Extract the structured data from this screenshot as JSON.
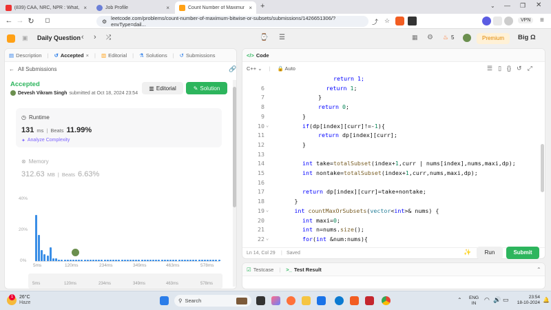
{
  "browser": {
    "tabs": [
      {
        "title": "(839) CAA, NRC, NPR : What, Why A",
        "active": false
      },
      {
        "title": "Job Profile",
        "active": false
      },
      {
        "title": "Count Number of Maximum Bi",
        "active": true
      }
    ],
    "new_tab": "+",
    "url": "leetcode.com/problems/count-number-of-maximum-bitwise-or-subsets/submissions/1426651306/?envType=dail...",
    "vpn_label": "VPN"
  },
  "header": {
    "daily_question": "Daily Question",
    "streak": "5",
    "premium": "Premium",
    "big_omega": "Big Ω"
  },
  "left_panel": {
    "tabs": [
      "Description",
      "Accepted",
      "Editorial",
      "Solutions",
      "Submissions"
    ],
    "all_submissions": "All Submissions",
    "status": "Accepted",
    "author": "Devesh Vikram Singh",
    "submitted": "submitted at Oct 18, 2024 23:54",
    "editorial_btn": "Editorial",
    "solution_btn": "Solution",
    "runtime": {
      "label": "Runtime",
      "value": "131",
      "unit": "ms",
      "beats_label": "Beats",
      "beats": "11.99%",
      "analyze": "Analyze Complexity"
    },
    "memory": {
      "label": "Memory",
      "value": "312.63",
      "unit": "MB",
      "beats_label": "Beats",
      "beats": "6.63%"
    },
    "chart": {
      "y_ticks": [
        "40%",
        "20%",
        "0%"
      ],
      "x_ticks": [
        "5ms",
        "120ms",
        "234ms",
        "349ms",
        "463ms",
        "578ms"
      ],
      "mini_x_ticks": [
        "5ms",
        "120ms",
        "234ms",
        "349ms",
        "463ms",
        "578ms"
      ],
      "bar_values": [
        33,
        19,
        8,
        5,
        4,
        10,
        2,
        2,
        1,
        1,
        1,
        1,
        1,
        1,
        1,
        1,
        1,
        1,
        1,
        1,
        1,
        1,
        1,
        1,
        1,
        1,
        1,
        1,
        1,
        1,
        1,
        1,
        1,
        1,
        1,
        1,
        1,
        1,
        1,
        1,
        1,
        1,
        1,
        1,
        1,
        1,
        1,
        1,
        1,
        1,
        1,
        1,
        1,
        1,
        1,
        1,
        1,
        1,
        1,
        1,
        1,
        1,
        1,
        1,
        1
      ]
    }
  },
  "code_panel": {
    "title": "Code",
    "language": "C++",
    "auto": "Auto",
    "top_partial": "return 1;",
    "lines": [
      {
        "n": "6",
        "indent": 5,
        "segs": [
          [
            "kw",
            "return "
          ],
          [
            "nm",
            "1"
          ],
          [
            "tx",
            ";"
          ]
        ]
      },
      {
        "n": "7",
        "indent": 4,
        "segs": [
          [
            "tx",
            "}"
          ]
        ]
      },
      {
        "n": "8",
        "indent": 4,
        "segs": [
          [
            "kw",
            "return "
          ],
          [
            "nm",
            "0"
          ],
          [
            "tx",
            ";"
          ]
        ]
      },
      {
        "n": "9",
        "indent": 2,
        "segs": [
          [
            "tx",
            "}"
          ]
        ]
      },
      {
        "n": "10",
        "indent": 2,
        "fold": true,
        "segs": [
          [
            "kw",
            "if"
          ],
          [
            "tx",
            "(dp[index][curr]!=-"
          ],
          [
            "nm",
            "1"
          ],
          [
            "tx",
            "){"
          ]
        ]
      },
      {
        "n": "11",
        "indent": 4,
        "segs": [
          [
            "kw",
            "return "
          ],
          [
            "tx",
            "dp[index][curr];"
          ]
        ]
      },
      {
        "n": "12",
        "indent": 2,
        "segs": [
          [
            "tx",
            "}"
          ]
        ]
      },
      {
        "n": "13",
        "indent": 0,
        "segs": []
      },
      {
        "n": "14",
        "indent": 2,
        "segs": [
          [
            "kw",
            "int "
          ],
          [
            "tx",
            "take="
          ],
          [
            "fn",
            "totalSubset"
          ],
          [
            "tx",
            "(index+"
          ],
          [
            "nm",
            "1"
          ],
          [
            "tx",
            ",curr | nums[index],nums,maxi,dp);"
          ]
        ]
      },
      {
        "n": "15",
        "indent": 2,
        "segs": [
          [
            "kw",
            "int "
          ],
          [
            "tx",
            "nontake="
          ],
          [
            "fn",
            "totalSubset"
          ],
          [
            "tx",
            "(index+"
          ],
          [
            "nm",
            "1"
          ],
          [
            "tx",
            ",curr,nums,maxi,dp);"
          ]
        ]
      },
      {
        "n": "16",
        "indent": 0,
        "segs": []
      },
      {
        "n": "17",
        "indent": 2,
        "segs": [
          [
            "kw",
            "return "
          ],
          [
            "tx",
            "dp[index][curr]=take+nontake;"
          ]
        ]
      },
      {
        "n": "18",
        "indent": 1,
        "segs": [
          [
            "tx",
            "}"
          ]
        ]
      },
      {
        "n": "19",
        "indent": 1,
        "fold": true,
        "segs": [
          [
            "kw",
            "int "
          ],
          [
            "fn",
            "countMaxOrSubsets"
          ],
          [
            "tx",
            "("
          ],
          [
            "ty",
            "vector"
          ],
          [
            "tx",
            "<"
          ],
          [
            "kw",
            "int"
          ],
          [
            "tx",
            ">& nums) {"
          ]
        ]
      },
      {
        "n": "20",
        "indent": 2,
        "segs": [
          [
            "kw",
            "int "
          ],
          [
            "tx",
            "maxi="
          ],
          [
            "nm",
            "0"
          ],
          [
            "tx",
            ";"
          ]
        ]
      },
      {
        "n": "21",
        "indent": 2,
        "segs": [
          [
            "kw",
            "int "
          ],
          [
            "tx",
            "n=nums."
          ],
          [
            "fn",
            "size"
          ],
          [
            "tx",
            "();"
          ]
        ]
      },
      {
        "n": "22",
        "indent": 2,
        "fold": true,
        "segs": [
          [
            "kw",
            "for"
          ],
          [
            "tx",
            "("
          ],
          [
            "kw",
            "int "
          ],
          [
            "tx",
            "&num:nums){"
          ]
        ]
      }
    ],
    "status": "Ln 14, Col 29",
    "saved": "Saved",
    "run": "Run",
    "submit": "Submit"
  },
  "bottom_panel": {
    "testcase": "Testcase",
    "result": "Test Result"
  },
  "taskbar": {
    "weather_temp": "26°C",
    "weather_desc": "Haze",
    "search": "Search",
    "lang1": "ENG",
    "lang2": "IN",
    "time": "23:54",
    "date": "18-10-2024",
    "badge": "1"
  }
}
